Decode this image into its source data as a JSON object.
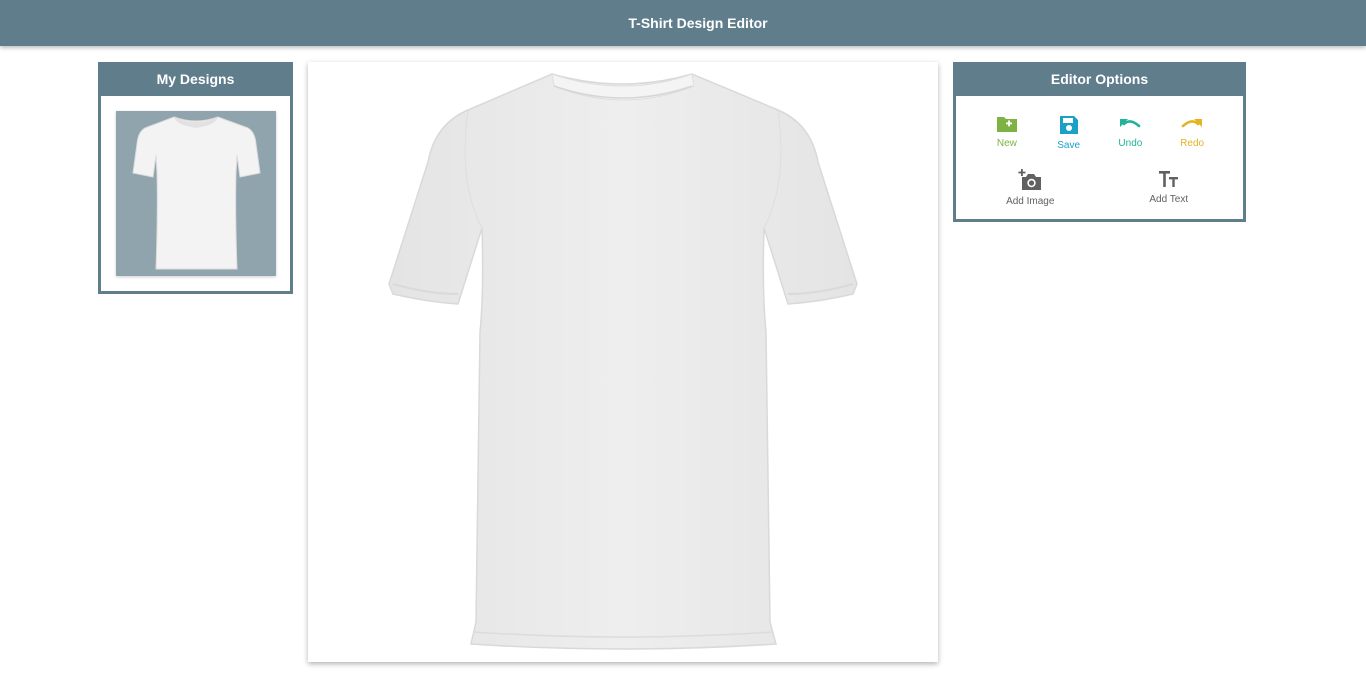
{
  "app": {
    "title": "T-Shirt Design Editor"
  },
  "left_panel": {
    "title": "My Designs",
    "designs": [
      {
        "name": "white-tshirt-design"
      }
    ]
  },
  "right_panel": {
    "title": "Editor Options",
    "options": [
      {
        "label": "New",
        "icon": "folder-plus-icon",
        "color": "#7cb342"
      },
      {
        "label": "Save",
        "icon": "floppy-disk-icon",
        "color": "#1ba1c8"
      },
      {
        "label": "Undo",
        "icon": "undo-icon",
        "color": "#1fb39a"
      },
      {
        "label": "Redo",
        "icon": "redo-icon",
        "color": "#e6b325"
      },
      {
        "label": "Add Image",
        "icon": "add-photo-icon",
        "color": "#616161"
      },
      {
        "label": "Add Text",
        "icon": "text-size-icon",
        "color": "#616161"
      }
    ]
  },
  "colors": {
    "primary": "#607d8b",
    "thumb_background": "#90a4ae",
    "shirt": "#ececec"
  }
}
